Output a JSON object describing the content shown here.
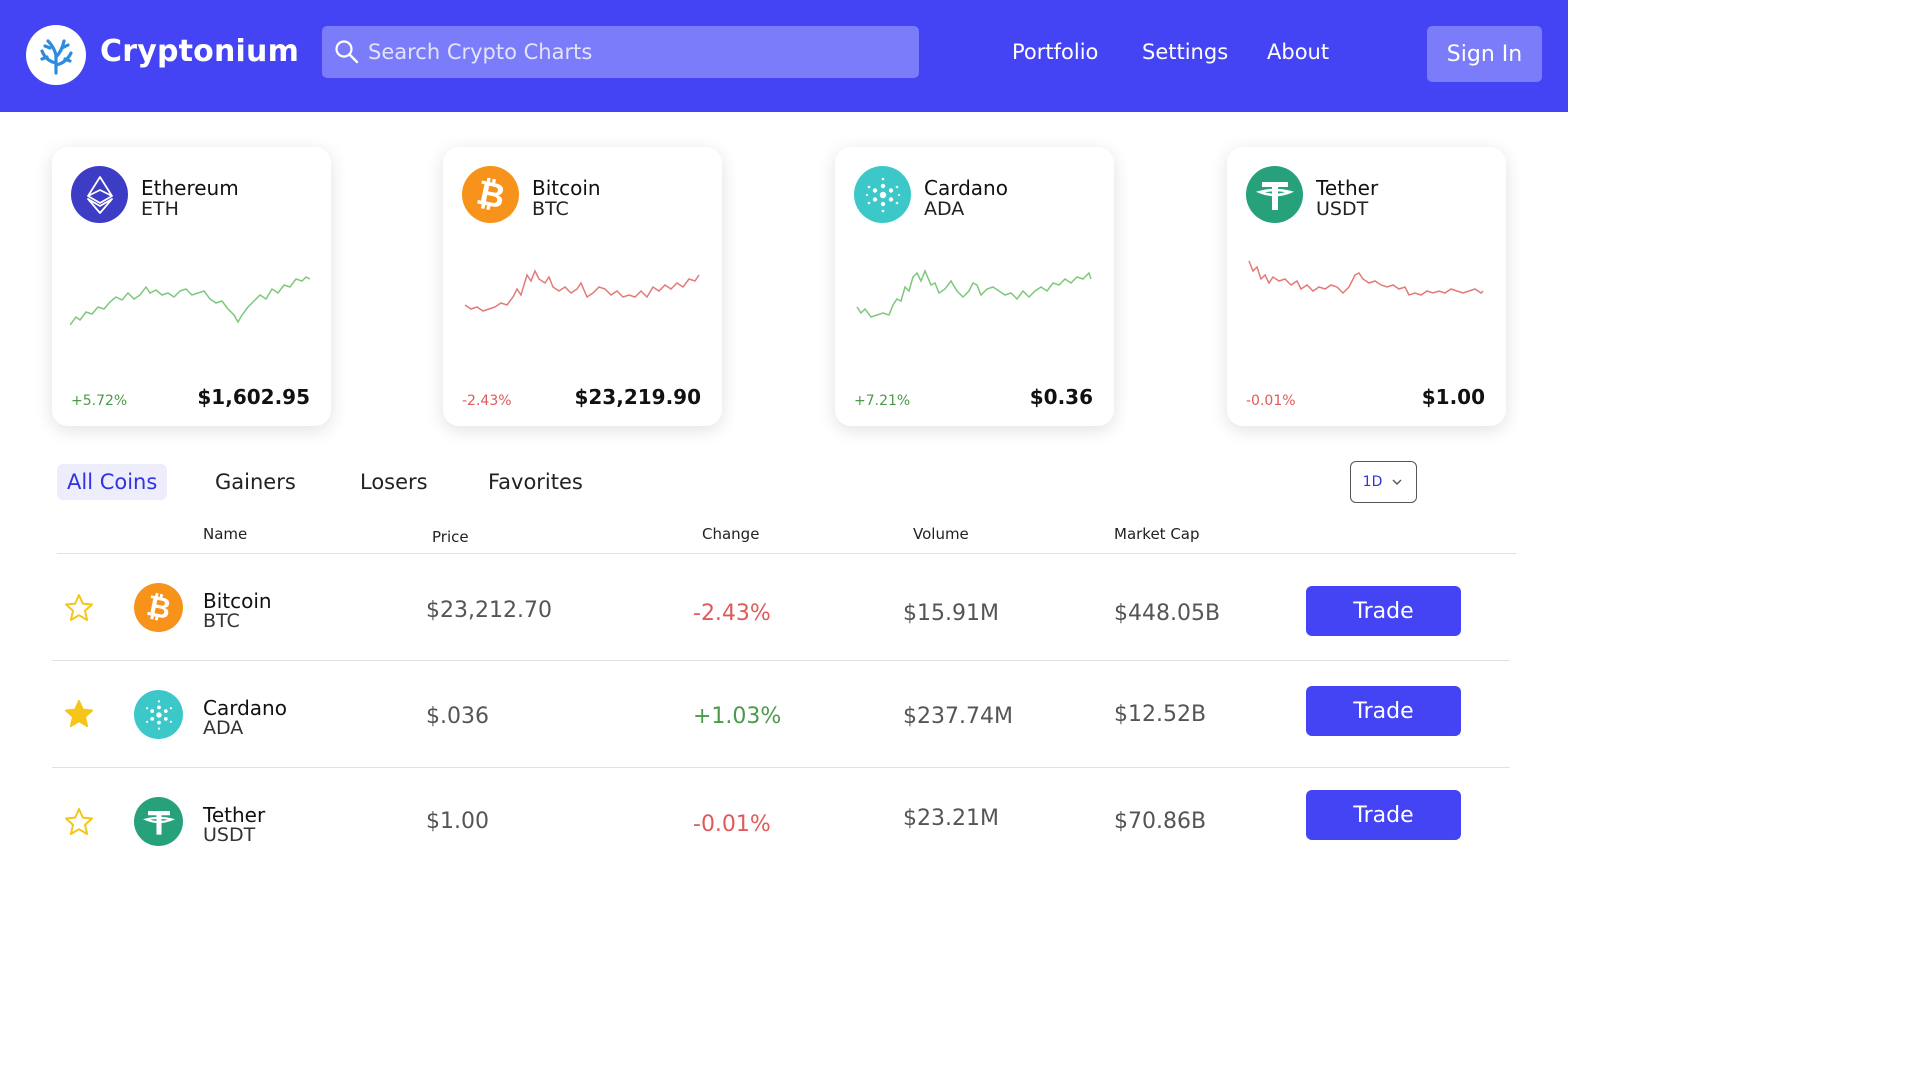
{
  "header": {
    "brand": "Cryptonium",
    "search_placeholder": "Search Crypto Charts",
    "nav": [
      "Portfolio",
      "Settings",
      "About"
    ],
    "sign_in": "Sign In"
  },
  "colors": {
    "primary": "#4444f5",
    "positive": "#4a9a4a",
    "negative": "#e05a5a",
    "star": "#f5c518"
  },
  "cards": [
    {
      "name": "Ethereum",
      "symbol": "ETH",
      "change": "+5.72%",
      "price": "$1,602.95",
      "trend": "up",
      "icon": "ethereum-icon",
      "icon_color": "#3c3cc4"
    },
    {
      "name": "Bitcoin",
      "symbol": "BTC",
      "change": "-2.43%",
      "price": "$23,219.90",
      "trend": "down",
      "icon": "bitcoin-icon",
      "icon_color": "#f7931a"
    },
    {
      "name": "Cardano",
      "symbol": "ADA",
      "change": "+7.21%",
      "price": "$0.36",
      "trend": "up",
      "icon": "cardano-icon",
      "icon_color": "#3cc8c8"
    },
    {
      "name": "Tether",
      "symbol": "USDT",
      "change": "-0.01%",
      "price": "$1.00",
      "trend": "down",
      "icon": "tether-icon",
      "icon_color": "#26a17b"
    }
  ],
  "tabs": [
    "All Coins",
    "Gainers",
    "Losers",
    "Favorites"
  ],
  "active_tab": "All Coins",
  "period": "1D",
  "table": {
    "headers": [
      "Name",
      "Price",
      "Change",
      "Volume",
      "Market Cap"
    ],
    "rows": [
      {
        "name": "Bitcoin",
        "symbol": "BTC",
        "price": "$23,212.70",
        "change": "-2.43%",
        "volume": "$15.91M",
        "market_cap": "$448.05B",
        "favorite": false,
        "trade": "Trade"
      },
      {
        "name": "Cardano",
        "symbol": "ADA",
        "price": "$.036",
        "change": "+1.03%",
        "volume": "$237.74M",
        "market_cap": "$12.52B",
        "favorite": true,
        "trade": "Trade"
      },
      {
        "name": "Tether",
        "symbol": "USDT",
        "price": "$1.00",
        "change": "-0.01%",
        "volume": "$23.21M",
        "market_cap": "$70.86B",
        "favorite": false,
        "trade": "Trade"
      }
    ]
  }
}
